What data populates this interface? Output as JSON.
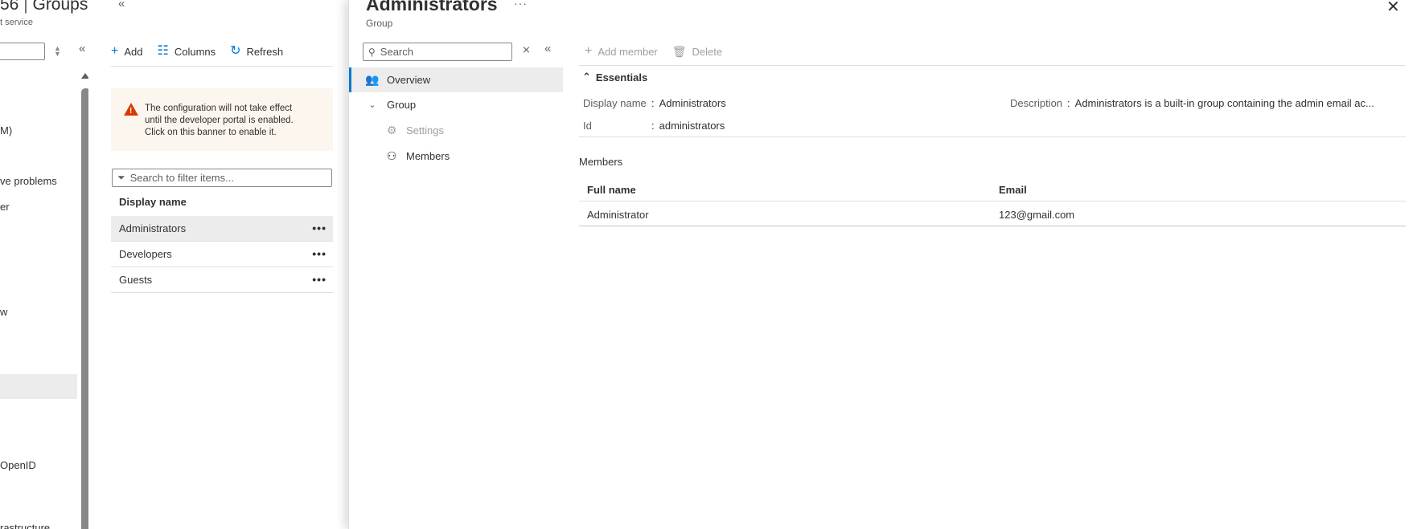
{
  "background": {
    "title_main": "56",
    "title_sep": " | ",
    "title_page": "Groups",
    "subtitle": "t service",
    "nav_items": [
      {
        "label": "M)"
      },
      {
        "label": "ve problems"
      },
      {
        "label": "er"
      },
      {
        "label": "w"
      },
      {
        "label": "OpenID"
      },
      {
        "label": "rastructure"
      }
    ]
  },
  "groups_pane": {
    "toolbar": {
      "add_label": "Add",
      "columns_label": "Columns",
      "refresh_label": "Refresh"
    },
    "banner": {
      "line1": "The configuration will not take effect",
      "line2": "until the developer portal is enabled.",
      "line3": "Click on this banner to enable it."
    },
    "filter_placeholder": "Search to filter items...",
    "column_header": "Display name",
    "rows": [
      {
        "name": "Administrators",
        "selected": true
      },
      {
        "name": "Developers",
        "selected": false
      },
      {
        "name": "Guests",
        "selected": false
      }
    ],
    "row_more_glyph": "•••"
  },
  "blade": {
    "title": "Administrators",
    "subtitle": "Group",
    "more_glyph": "···",
    "close_glyph": "✕",
    "search_placeholder": "Search",
    "resource_menu": [
      {
        "label": "Overview",
        "icon": "group-users-icon"
      },
      {
        "label": "Group",
        "icon": "chevron-down-icon"
      },
      {
        "label": "Settings",
        "icon": "gear-icon"
      },
      {
        "label": "Members",
        "icon": "person-icon"
      }
    ],
    "toolbar": {
      "add_member_label": "Add member",
      "delete_label": "Delete"
    },
    "essentials": {
      "toggle_label": "Essentials",
      "display_name_key": "Display name",
      "display_name_value": "Administrators",
      "id_key": "Id",
      "id_value": "administrators",
      "description_key": "Description",
      "description_value": "Administrators is a built-in group containing the admin email ac..."
    },
    "members": {
      "title": "Members",
      "columns": [
        "Full name",
        "Email"
      ],
      "rows": [
        {
          "full_name": "Administrator",
          "email": "123@gmail.com"
        }
      ]
    }
  },
  "colors": {
    "accent": "#0078d4",
    "warning": "#d83b01",
    "banner_bg": "#fdf6ee",
    "selected_bg": "#ececec"
  }
}
